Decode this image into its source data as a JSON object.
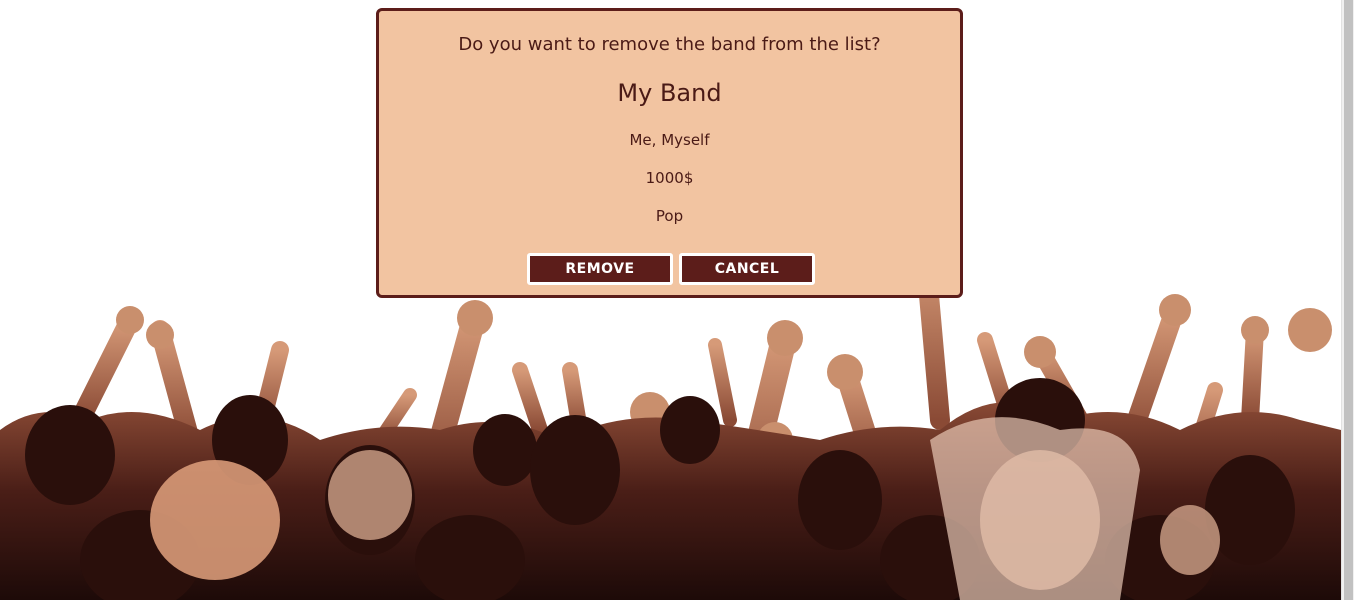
{
  "dialog": {
    "question": "Do you want to remove the band from the list?",
    "band_name": "My Band",
    "members": "Me, Myself",
    "price": "1000$",
    "genre": "Pop",
    "remove_label": "REMOVE",
    "cancel_label": "CANCEL"
  },
  "colors": {
    "dialog_background": "#f2c4a1",
    "dialog_border": "#5c1d1a",
    "button_background": "#5c1d1a",
    "text": "#4a1a16"
  },
  "background_image": "concert-crowd"
}
